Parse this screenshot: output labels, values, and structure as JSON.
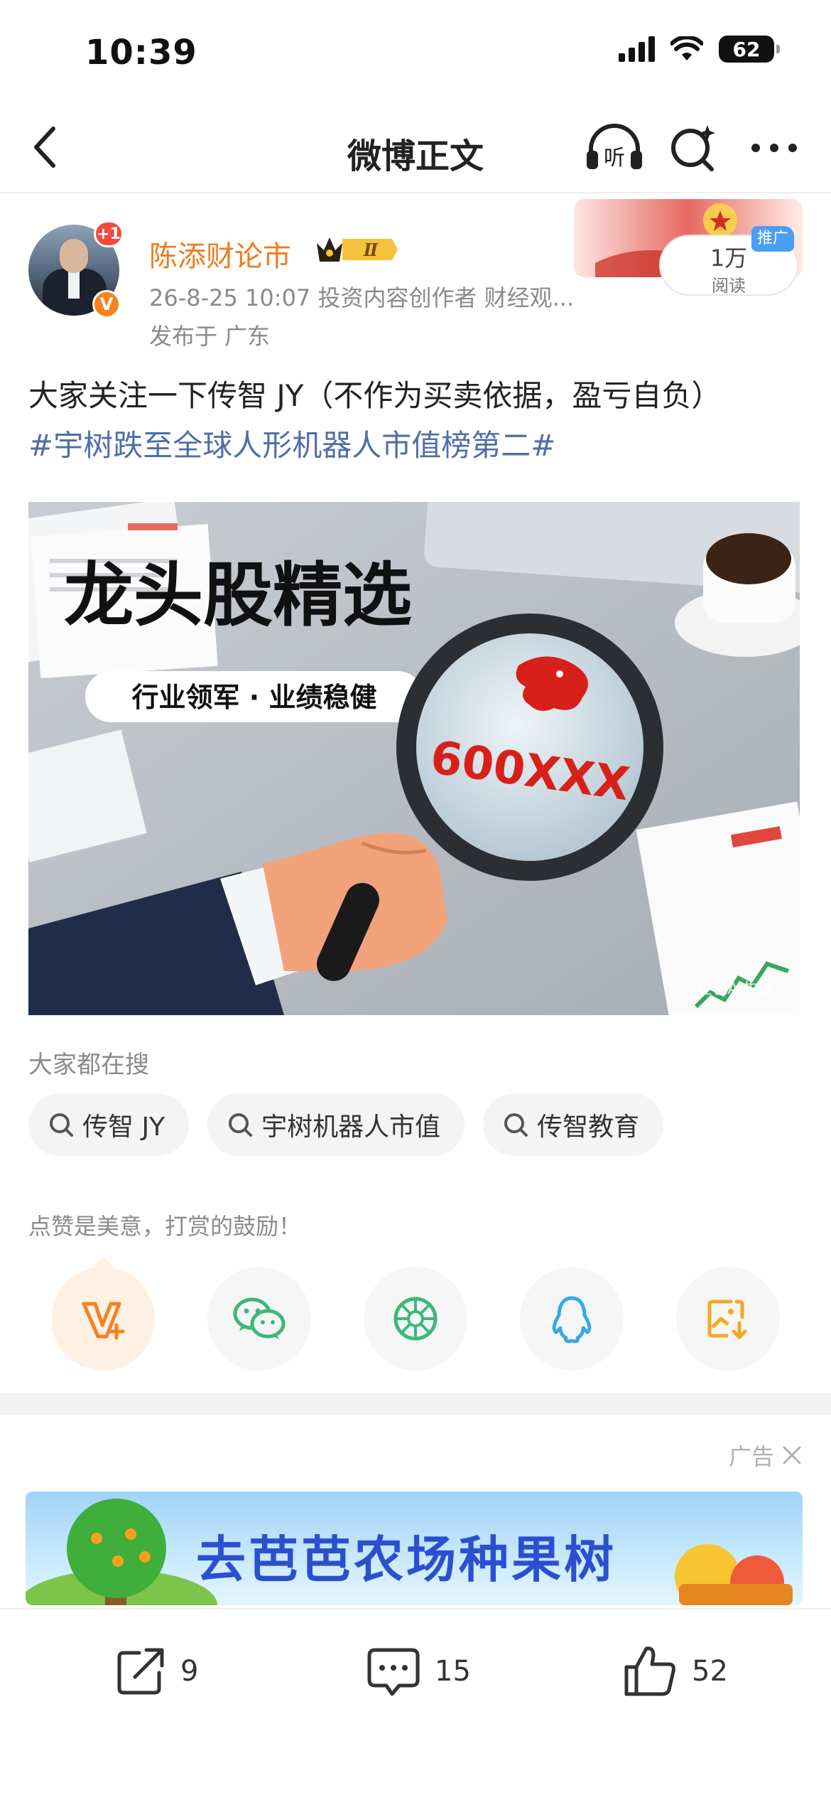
{
  "status_bar": {
    "time": "10:39",
    "battery": "62"
  },
  "nav": {
    "title": "微博正文"
  },
  "author": {
    "name": "陈添财论市",
    "level_badge": "Ⅱ",
    "plus_badge": "+1",
    "verified_badge": "V",
    "meta": "26-8-25 10:07  投资内容创作者 财经观...",
    "location": "发布于 广东",
    "read_count": "1万",
    "read_label": "阅读",
    "promo_tag": "推广"
  },
  "post": {
    "text": "大家关注一下传智 JY（不作为买卖依据，盈亏自负）",
    "hashtag": "#宇树跌至全球人形机器人市值榜第二#"
  },
  "image": {
    "headline": "龙头股精选",
    "subheadline": "行业领军 · 业绩稳健",
    "stock_code": "600XXX",
    "watermark": "豆包AI生成"
  },
  "hot_search": {
    "title": "大家都在搜",
    "chips": [
      {
        "label": "传智 JY"
      },
      {
        "label": "宇树机器人市值"
      },
      {
        "label": "传智教育"
      }
    ]
  },
  "reward": {
    "title": "点赞是美意，打赏的鼓励！"
  },
  "ad": {
    "label": "广告",
    "banner_text": "去芭芭农场种果树"
  },
  "actions": {
    "repost_count": "9",
    "comment_count": "15",
    "like_count": "52"
  },
  "colors": {
    "accent_orange": "#f07b1f",
    "hashtag_blue": "#4f6ea9",
    "badge_red": "#f24a3a",
    "promo_blue": "#4a9df5",
    "wechat_green": "#3cb878",
    "qq_blue": "#37a8e8",
    "save_orange": "#f5a623"
  }
}
